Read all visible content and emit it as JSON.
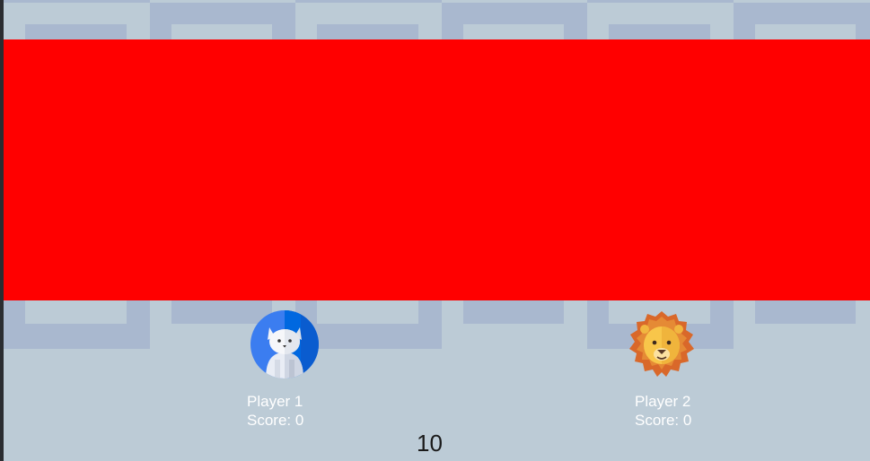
{
  "colors": {
    "tile_light": "#bccbd6",
    "tile_dark": "#a9b8cf",
    "banner": "#ff0000",
    "label_text": "#ffffff",
    "timer_text": "#1a1a1a"
  },
  "players": [
    {
      "icon": "cat-avatar-icon",
      "name": "Player 1",
      "score": "Score: 0"
    },
    {
      "icon": "lion-avatar-icon",
      "name": "Player 2",
      "score": "Score: 0"
    }
  ],
  "timer": "10"
}
